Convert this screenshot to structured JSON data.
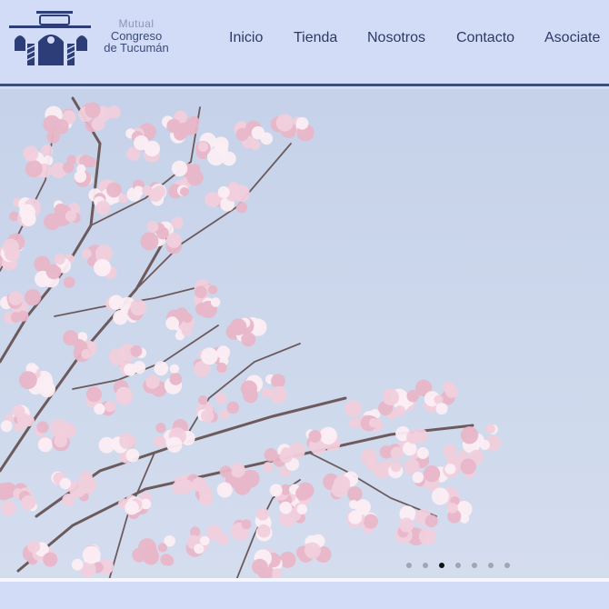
{
  "brand": {
    "line1": "Mutual",
    "line2": "Congreso",
    "line3": "de Tucumán"
  },
  "nav": {
    "items": [
      "Inicio",
      "Tienda",
      "Nosotros",
      "Contacto",
      "Asociate"
    ]
  },
  "slider": {
    "slide_count": 7,
    "active_index": 2
  },
  "colors": {
    "header_bg": "#d3dcf6",
    "nav_text": "#2c3a66",
    "header_rule": "#3d5078",
    "logo_primary": "#2c3d78",
    "blossom": "#f1cfdc"
  }
}
